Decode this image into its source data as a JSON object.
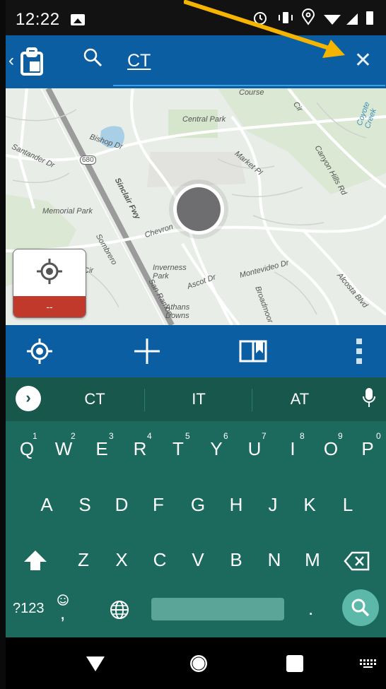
{
  "status_bar": {
    "time": "12:22"
  },
  "search": {
    "query": "CT"
  },
  "map": {
    "labels": [
      "Central Park",
      "Bishop Dr",
      "Market Pl",
      "Canyon Hills Rd",
      "Santander Dr",
      "Memorial Park",
      "Sinclair Fwy",
      "Chevron",
      "Sombrero",
      "Cir",
      "Inverness Park",
      "Ascot Dr",
      "Montevideo Dr",
      "San Ramon",
      "Athans Downs",
      "Broadmoor",
      "Alcosta Blvd",
      "Coyote Creek",
      "Course",
      "Cir",
      "680"
    ]
  },
  "location_widget": {
    "status": "--"
  },
  "keyboard": {
    "suggestions": [
      "CT",
      "IT",
      "AT"
    ],
    "row1": [
      "Q",
      "W",
      "E",
      "R",
      "T",
      "Y",
      "U",
      "I",
      "O",
      "P"
    ],
    "row1_nums": [
      "1",
      "2",
      "3",
      "4",
      "5",
      "6",
      "7",
      "8",
      "9",
      "0"
    ],
    "row2": [
      "A",
      "S",
      "D",
      "F",
      "G",
      "H",
      "J",
      "K",
      "L"
    ],
    "row3": [
      "Z",
      "X",
      "C",
      "V",
      "B",
      "N",
      "M"
    ],
    "symbols_key": "?123",
    "comma_key": ",",
    "period_key": "."
  },
  "colors": {
    "app_bar": "#0b5ea1",
    "keyboard": "#1b6a5d",
    "accent_arrow": "#f5b400",
    "alert": "#c0392b"
  }
}
